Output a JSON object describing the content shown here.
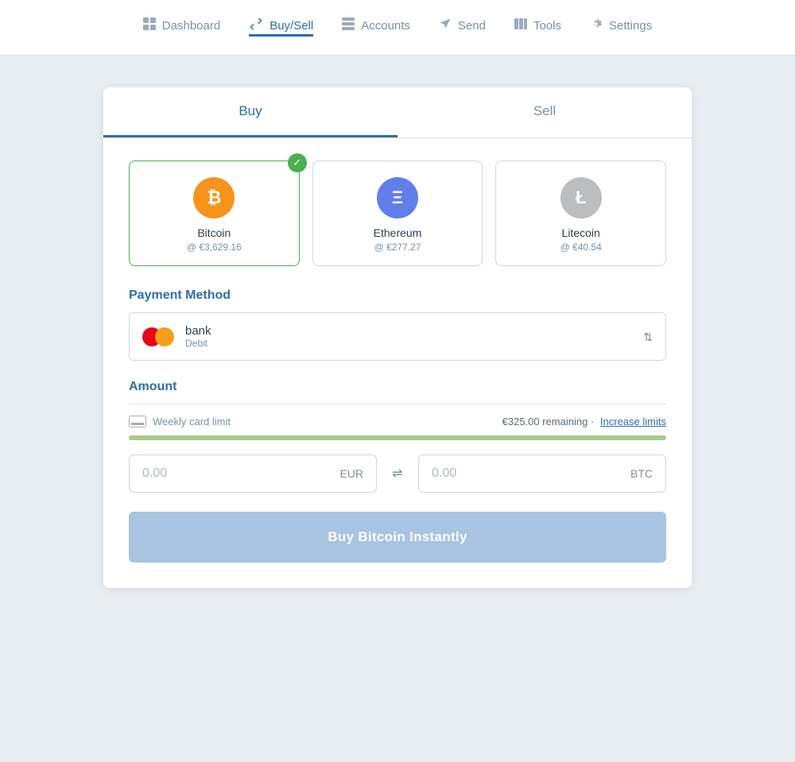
{
  "nav": {
    "items": [
      {
        "id": "dashboard",
        "label": "Dashboard",
        "icon": "⊞",
        "active": false
      },
      {
        "id": "buysell",
        "label": "Buy/Sell",
        "icon": "⇄",
        "active": true
      },
      {
        "id": "accounts",
        "label": "Accounts",
        "icon": "▤",
        "active": false
      },
      {
        "id": "send",
        "label": "Send",
        "icon": "➤",
        "active": false
      },
      {
        "id": "tools",
        "label": "Tools",
        "icon": "⊞",
        "active": false
      },
      {
        "id": "settings",
        "label": "Settings",
        "icon": "⚙",
        "active": false
      }
    ]
  },
  "tabs": {
    "buy_label": "Buy",
    "sell_label": "Sell",
    "active": "buy"
  },
  "crypto": {
    "coins": [
      {
        "id": "bitcoin",
        "name": "Bitcoin",
        "price": "@ €3,629.16",
        "symbol": "₿",
        "type": "btc",
        "selected": true
      },
      {
        "id": "ethereum",
        "name": "Ethereum",
        "price": "@ €277.27",
        "symbol": "Ξ",
        "type": "eth",
        "selected": false
      },
      {
        "id": "litecoin",
        "name": "Litecoin",
        "price": "@ €40.54",
        "symbol": "Ł",
        "type": "ltc",
        "selected": false
      }
    ]
  },
  "payment": {
    "section_label": "Payment Method",
    "method_name": "bank",
    "method_type": "Debit"
  },
  "amount": {
    "section_label": "Amount",
    "limit_label": "Weekly card limit",
    "remaining": "€325.00 remaining",
    "dot": "·",
    "increase_link": "Increase limits",
    "eur_value": "0.00",
    "eur_currency": "EUR",
    "btc_value": "0.00",
    "btc_currency": "BTC",
    "eur_placeholder": "0.00",
    "btc_placeholder": "0.00"
  },
  "buy_button": {
    "label": "Buy Bitcoin Instantly"
  }
}
